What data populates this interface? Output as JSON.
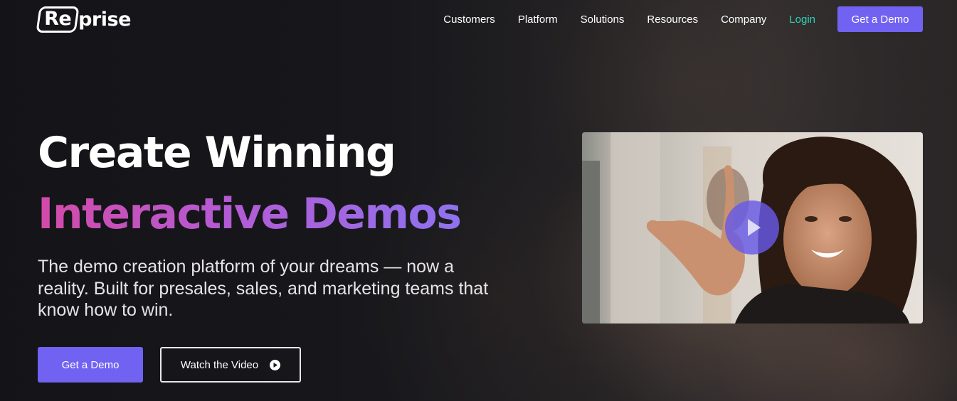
{
  "brand": {
    "logo_boxed": "Re",
    "logo_rest": "prise"
  },
  "nav": {
    "items": [
      {
        "label": "Customers"
      },
      {
        "label": "Platform"
      },
      {
        "label": "Solutions"
      },
      {
        "label": "Resources"
      },
      {
        "label": "Company"
      }
    ],
    "login": "Login",
    "cta": "Get a Demo"
  },
  "hero": {
    "title_line1": "Create Winning",
    "title_line2": "Interactive Demos",
    "subtitle": "The demo creation platform of your dreams — now a reality. Built for presales, sales, and marketing teams that know how to win.",
    "primary_button": "Get a Demo",
    "secondary_button": "Watch the Video"
  },
  "video": {
    "play_icon": "play-icon"
  },
  "colors": {
    "accent": "#7262f2",
    "login": "#2ed3b7",
    "gradient_start": "#d34aa8",
    "gradient_end": "#8f72f0",
    "background": "#1d1d21"
  }
}
